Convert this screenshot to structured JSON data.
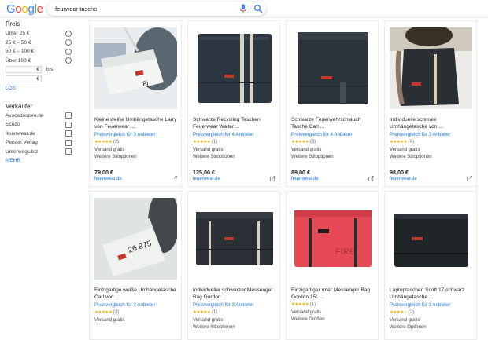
{
  "search": {
    "query": "feurwear tasche",
    "logo": "Google"
  },
  "colors": {
    "google_blue": "#4285f4",
    "google_red": "#ea4335",
    "google_yellow": "#fbbc05",
    "google_green": "#34a853",
    "link": "#1a73e8"
  },
  "sidebar": {
    "price_title": "Preis",
    "price_options": [
      "Unter 25 €",
      "25 € – 50 €",
      "50 € – 100 €",
      "Über 100 €"
    ],
    "range_min_currency": "€",
    "range_max_currency": "€",
    "range_sep": "bis",
    "go_label": "LOS",
    "seller_title": "Verkäufer",
    "sellers": [
      "Avocadostore.de",
      "Ecozo",
      "feuerwear.de",
      "Persen Verlag",
      "Unterwegs.biz"
    ],
    "more_label": "MEHR"
  },
  "products": [
    {
      "title": "Kleine weiße Umhängetasche Larry von Feuerwear ...",
      "compare": "Preisvergleich für 3 Anbieter",
      "stars": "★★★★★",
      "reviews": "(2)",
      "ship": "Versand gratis",
      "options": "Weitere Stiloptionen",
      "price": "79,00 €",
      "shop": "feuerwear.de"
    },
    {
      "title": "Schwarze Recycling Taschen Feuerwear Walter ...",
      "compare": "Preisvergleich für 4 Anbieter",
      "stars": "★★★★★",
      "reviews": "(1)",
      "ship": "Versand gratis",
      "options": "Weitere Stiloptionen",
      "price": "125,00 €",
      "shop": "feuerwear.de"
    },
    {
      "title": "Schwarze Feuerwehrschlauch Tasche Carl ...",
      "compare": "Preisvergleich für 4 Anbieter",
      "stars": "★★★★★",
      "reviews": "(3)",
      "ship": "Versand gratis",
      "options": "Weitere Stiloptionen",
      "price": "89,00 €",
      "shop": "feuerwear.de"
    },
    {
      "title": "Individuelle schmale Umhängetasche von ...",
      "compare": "Preisvergleich für 3 Anbieter",
      "stars": "★★★★★",
      "reviews": "(4)",
      "ship": "Versand gratis",
      "options": "Weitere Stiloptionen",
      "price": "98,00 €",
      "shop": "feuerwear.de"
    },
    {
      "title": "Einzigartige weiße Umhängetasche Carl von ...",
      "compare": "Preisvergleich für 3 Anbieter",
      "stars": "★★★★★",
      "reviews": "(3)",
      "ship": "Versand gratis",
      "options": "",
      "price": "",
      "shop": ""
    },
    {
      "title": "Individueller schwarzer Messenger Bag Gordon ...",
      "compare": "Preisvergleich für 3 Anbieter",
      "stars": "★★★★★",
      "reviews": "(1)",
      "ship": "Versand gratis",
      "options": "Weitere Stiloptionen",
      "price": "",
      "shop": ""
    },
    {
      "title": "Einzigartiger roter Messenger Bag Gordon 15L ...",
      "compare": "",
      "stars": "★★★★★",
      "reviews": "(1)",
      "ship": "Versand gratis",
      "options": "Weitere Größen",
      "price": "",
      "shop": ""
    },
    {
      "title": "Laptoptaschen Scott 17 schwarz Umhängetasche ...",
      "compare": "Preisvergleich für 3 Anbieter",
      "stars": "★★★★☆",
      "reviews": "(2)",
      "ship": "Versand gratis",
      "options": "Weitere Optionen",
      "price": "",
      "shop": ""
    }
  ],
  "icons": {
    "mic": "mic-icon",
    "search": "search-icon",
    "external": "open-in-new-icon"
  }
}
